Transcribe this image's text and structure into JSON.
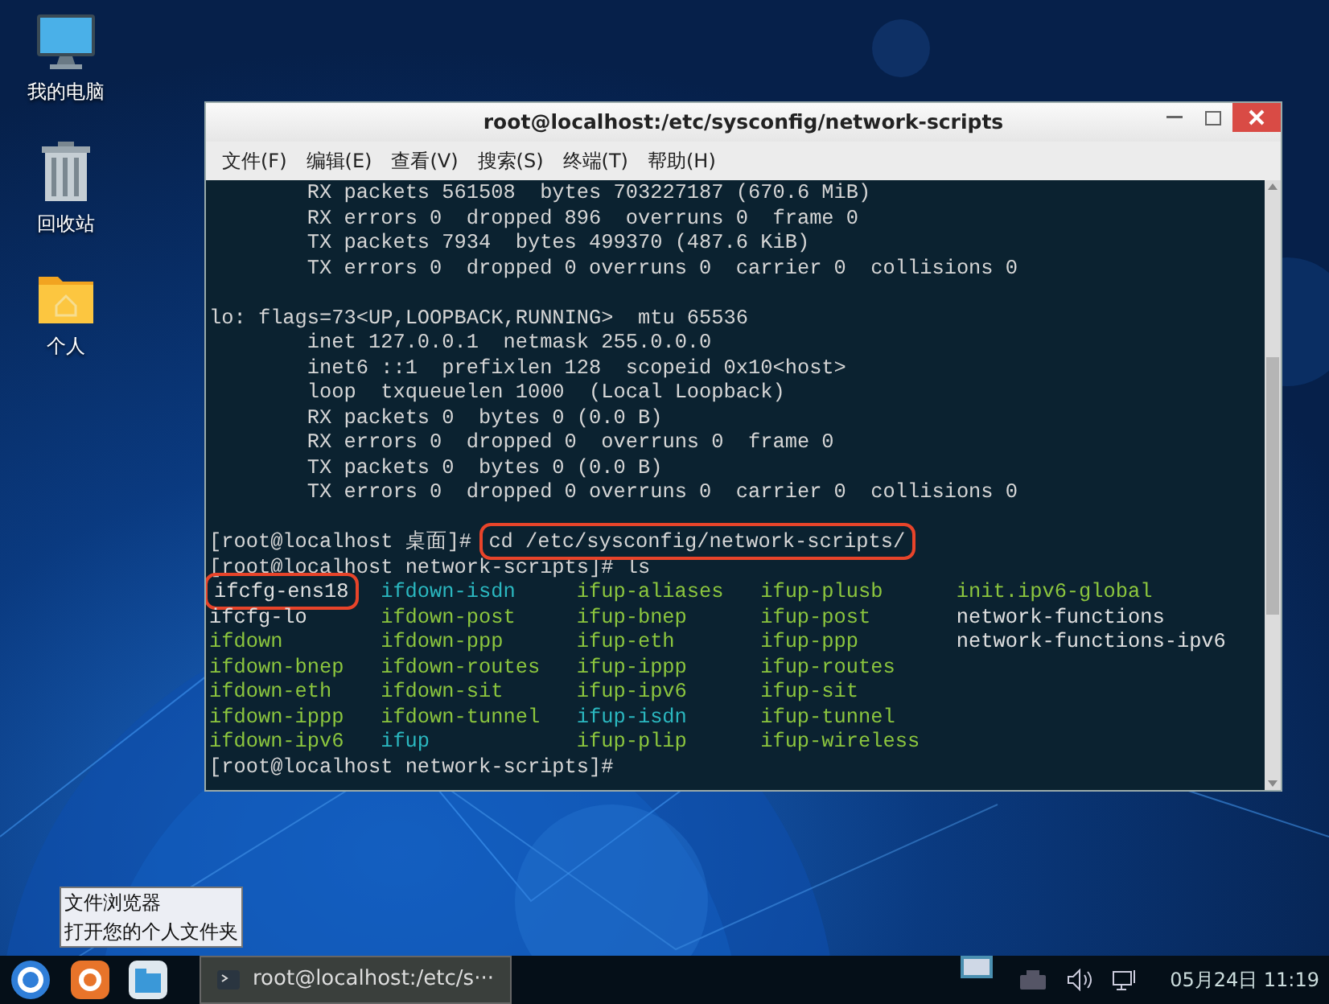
{
  "desktop_icons": [
    {
      "label": "我的电脑",
      "kind": "computer"
    },
    {
      "label": "回收站",
      "kind": "trash"
    },
    {
      "label": "个人",
      "kind": "home"
    }
  ],
  "window": {
    "title": "root@localhost:/etc/sysconfig/network-scripts",
    "menu": [
      "文件(F)",
      "编辑(E)",
      "查看(V)",
      "搜索(S)",
      "终端(T)",
      "帮助(H)"
    ],
    "terminal": {
      "output_blocks": [
        [
          {
            "text": "        RX packets 561508  bytes 703227187 (670.6 MiB)"
          },
          {
            "text": "        RX errors 0  dropped 896  overruns 0  frame 0"
          },
          {
            "text": "        TX packets 7934  bytes 499370 (487.6 KiB)"
          },
          {
            "text": "        TX errors 0  dropped 0 overruns 0  carrier 0  collisions 0"
          }
        ],
        [
          {
            "text": "lo: flags=73<UP,LOOPBACK,RUNNING>  mtu 65536"
          },
          {
            "text": "        inet 127.0.0.1  netmask 255.0.0.0"
          },
          {
            "text": "        inet6 ::1  prefixlen 128  scopeid 0x10<host>"
          },
          {
            "text": "        loop  txqueuelen 1000  (Local Loopback)"
          },
          {
            "text": "        RX packets 0  bytes 0 (0.0 B)"
          },
          {
            "text": "        RX errors 0  dropped 0  overruns 0  frame 0"
          },
          {
            "text": "        TX packets 0  bytes 0 (0.0 B)"
          },
          {
            "text": "        TX errors 0  dropped 0 overruns 0  carrier 0  collisions 0"
          }
        ]
      ],
      "commands": [
        {
          "prompt": "[root@localhost 桌面]#",
          "command": "cd /etc/sysconfig/network-scripts/",
          "highlighted": true
        },
        {
          "prompt": "[root@localhost network-scripts]#",
          "command": "ls",
          "highlighted": false
        }
      ],
      "listing": [
        [
          {
            "name": "ifcfg-ens18",
            "kind": "plain",
            "highlighted": true
          },
          {
            "name": "ifdown-isdn",
            "kind": "link",
            "highlighted": false
          },
          {
            "name": "ifup-aliases",
            "kind": "exec",
            "highlighted": false
          },
          {
            "name": "ifup-plusb",
            "kind": "exec",
            "highlighted": false
          },
          {
            "name": "init.ipv6-global",
            "kind": "exec",
            "highlighted": false
          }
        ],
        [
          {
            "name": "ifcfg-lo",
            "kind": "plain",
            "highlighted": false
          },
          {
            "name": "ifdown-post",
            "kind": "exec",
            "highlighted": false
          },
          {
            "name": "ifup-bnep",
            "kind": "exec",
            "highlighted": false
          },
          {
            "name": "ifup-post",
            "kind": "exec",
            "highlighted": false
          },
          {
            "name": "network-functions",
            "kind": "plain",
            "highlighted": false
          }
        ],
        [
          {
            "name": "ifdown",
            "kind": "exec",
            "highlighted": false
          },
          {
            "name": "ifdown-ppp",
            "kind": "exec",
            "highlighted": false
          },
          {
            "name": "ifup-eth",
            "kind": "exec",
            "highlighted": false
          },
          {
            "name": "ifup-ppp",
            "kind": "exec",
            "highlighted": false
          },
          {
            "name": "network-functions-ipv6",
            "kind": "plain",
            "highlighted": false
          }
        ],
        [
          {
            "name": "ifdown-bnep",
            "kind": "exec",
            "highlighted": false
          },
          {
            "name": "ifdown-routes",
            "kind": "exec",
            "highlighted": false
          },
          {
            "name": "ifup-ippp",
            "kind": "exec",
            "highlighted": false
          },
          {
            "name": "ifup-routes",
            "kind": "exec",
            "highlighted": false
          }
        ],
        [
          {
            "name": "ifdown-eth",
            "kind": "exec",
            "highlighted": false
          },
          {
            "name": "ifdown-sit",
            "kind": "exec",
            "highlighted": false
          },
          {
            "name": "ifup-ipv6",
            "kind": "exec",
            "highlighted": false
          },
          {
            "name": "ifup-sit",
            "kind": "exec",
            "highlighted": false
          }
        ],
        [
          {
            "name": "ifdown-ippp",
            "kind": "exec",
            "highlighted": false
          },
          {
            "name": "ifdown-tunnel",
            "kind": "exec",
            "highlighted": false
          },
          {
            "name": "ifup-isdn",
            "kind": "link",
            "highlighted": false
          },
          {
            "name": "ifup-tunnel",
            "kind": "exec",
            "highlighted": false
          }
        ],
        [
          {
            "name": "ifdown-ipv6",
            "kind": "exec",
            "highlighted": false
          },
          {
            "name": "ifup",
            "kind": "link",
            "highlighted": false
          },
          {
            "name": "ifup-plip",
            "kind": "exec",
            "highlighted": false
          },
          {
            "name": "ifup-wireless",
            "kind": "exec",
            "highlighted": false
          }
        ]
      ],
      "final_prompt": "[root@localhost network-scripts]#"
    }
  },
  "tooltip": {
    "title": "文件浏览器",
    "description": "打开您的个人文件夹"
  },
  "taskbar": {
    "launchers": [
      {
        "kind": "start"
      },
      {
        "kind": "browser"
      },
      {
        "kind": "files"
      }
    ],
    "tasks": [
      {
        "label": "root@localhost:/etc/s···"
      }
    ],
    "clock": "05月24日 11:19"
  }
}
